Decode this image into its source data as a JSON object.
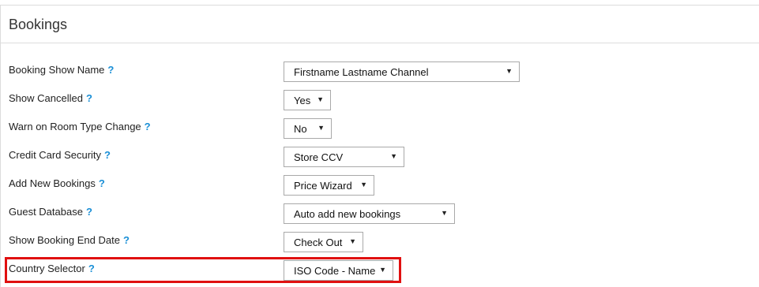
{
  "panel": {
    "title": "Bookings",
    "help_glyph": "?"
  },
  "settings": [
    {
      "label": "Booking Show Name",
      "value": "Firstname Lastname Channel"
    },
    {
      "label": "Show Cancelled",
      "value": "Yes"
    },
    {
      "label": "Warn on Room Type Change",
      "value": "No"
    },
    {
      "label": "Credit Card Security",
      "value": "Store CCV"
    },
    {
      "label": "Add New Bookings",
      "value": "Price Wizard"
    },
    {
      "label": "Guest Database",
      "value": "Auto add new bookings"
    },
    {
      "label": "Show Booking End Date",
      "value": "Check Out"
    },
    {
      "label": "Country Selector",
      "value": "ISO Code - Name"
    }
  ],
  "icons": {
    "help": "help-icon",
    "dropdown": "chevron-down-icon"
  },
  "colors": {
    "help": "#1a8fd6",
    "highlight": "#e01010",
    "border": "#dcdcdc"
  },
  "highlighted_setting": "Country Selector"
}
